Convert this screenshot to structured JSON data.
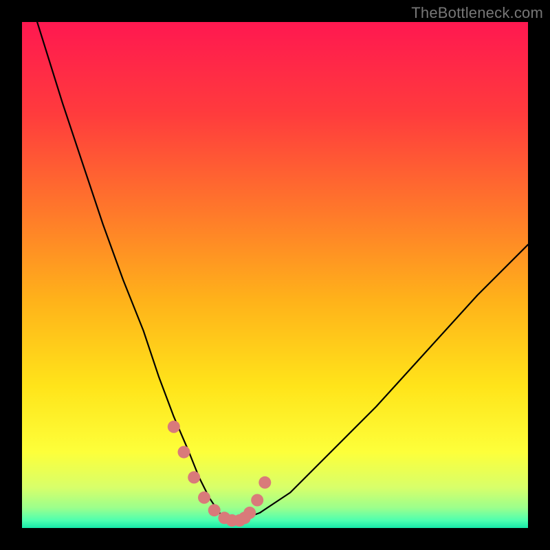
{
  "watermark": "TheBottleneck.com",
  "chart_data": {
    "type": "line",
    "title": "",
    "xlabel": "",
    "ylabel": "",
    "xlim": [
      0,
      100
    ],
    "ylim": [
      0,
      100
    ],
    "grid": false,
    "legend": false,
    "series": [
      {
        "name": "bottleneck-curve",
        "x": [
          3,
          8,
          12,
          16,
          20,
          24,
          27,
          30,
          33,
          35,
          37,
          39,
          41,
          43,
          47,
          53,
          60,
          70,
          80,
          90,
          100
        ],
        "y": [
          100,
          84,
          72,
          60,
          49,
          39,
          30,
          22,
          15,
          10,
          6,
          3,
          1.5,
          1.5,
          3,
          7,
          14,
          24,
          35,
          46,
          56
        ]
      }
    ],
    "highlight_points": {
      "name": "marker-dots",
      "color": "#d97a7a",
      "x": [
        30,
        32,
        34,
        36,
        38,
        40,
        41.5,
        43,
        44,
        45,
        46.5,
        48
      ],
      "y": [
        20,
        15,
        10,
        6,
        3.5,
        2,
        1.5,
        1.5,
        2,
        3,
        5.5,
        9
      ]
    },
    "background_gradient": {
      "stops": [
        {
          "pos": 0.0,
          "color": "#ff1850"
        },
        {
          "pos": 0.18,
          "color": "#ff3b3d"
        },
        {
          "pos": 0.38,
          "color": "#ff7a2a"
        },
        {
          "pos": 0.55,
          "color": "#ffb21a"
        },
        {
          "pos": 0.72,
          "color": "#ffe41a"
        },
        {
          "pos": 0.85,
          "color": "#fdff3a"
        },
        {
          "pos": 0.92,
          "color": "#d8ff6a"
        },
        {
          "pos": 0.96,
          "color": "#9cff8c"
        },
        {
          "pos": 0.985,
          "color": "#4effb0"
        },
        {
          "pos": 1.0,
          "color": "#17e8a8"
        }
      ]
    }
  }
}
